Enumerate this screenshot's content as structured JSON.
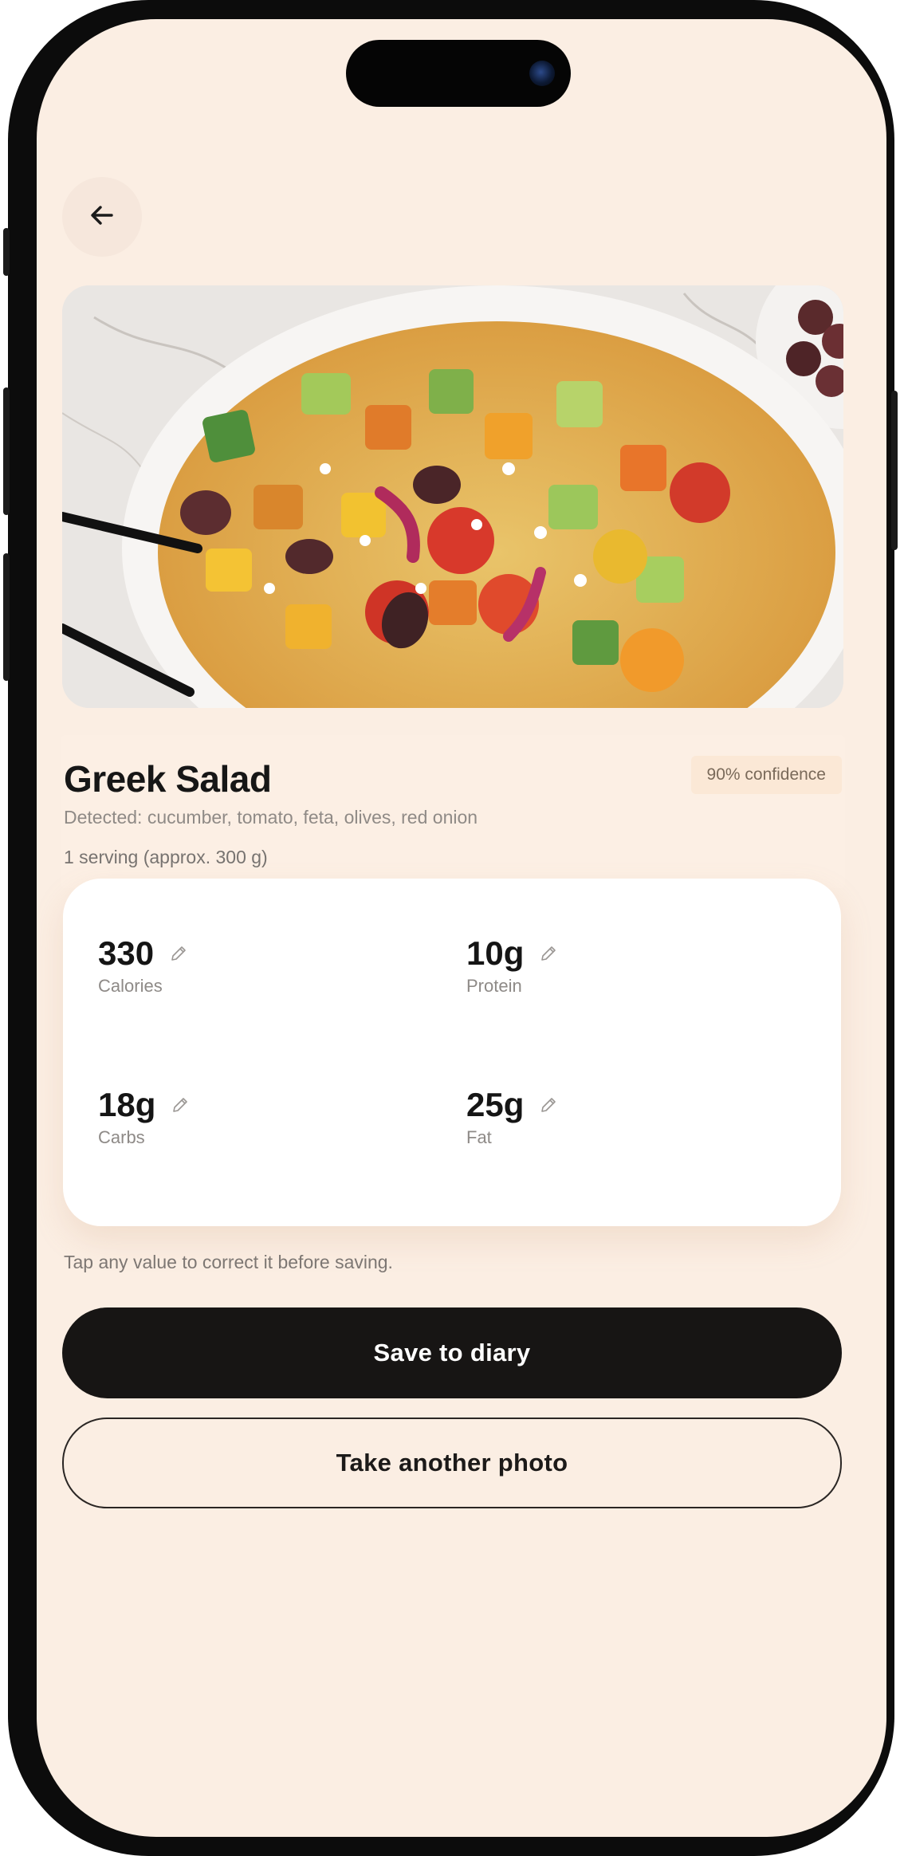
{
  "nav": {
    "back_icon": "arrow-left-icon"
  },
  "photo": {
    "subject": "greek-salad-photo"
  },
  "result": {
    "dish_name": "Greek Salad",
    "confidence": "90% confidence",
    "detected": "Detected: cucumber, tomato, feta, olives, red onion",
    "serving": "1 serving (approx. 300 g)"
  },
  "macros": [
    {
      "value": "330",
      "label": "Calories"
    },
    {
      "value": "10g",
      "label": "Protein"
    },
    {
      "value": "18g",
      "label": "Carbs"
    },
    {
      "value": "25g",
      "label": "Fat"
    }
  ],
  "hint": "Tap any value to correct it before saving.",
  "actions": {
    "save_label": "Save to diary",
    "retake_label": "Take another photo"
  },
  "colors": {
    "background": "#fbeee3",
    "primary_button": "#171514",
    "card": "#ffffff"
  }
}
